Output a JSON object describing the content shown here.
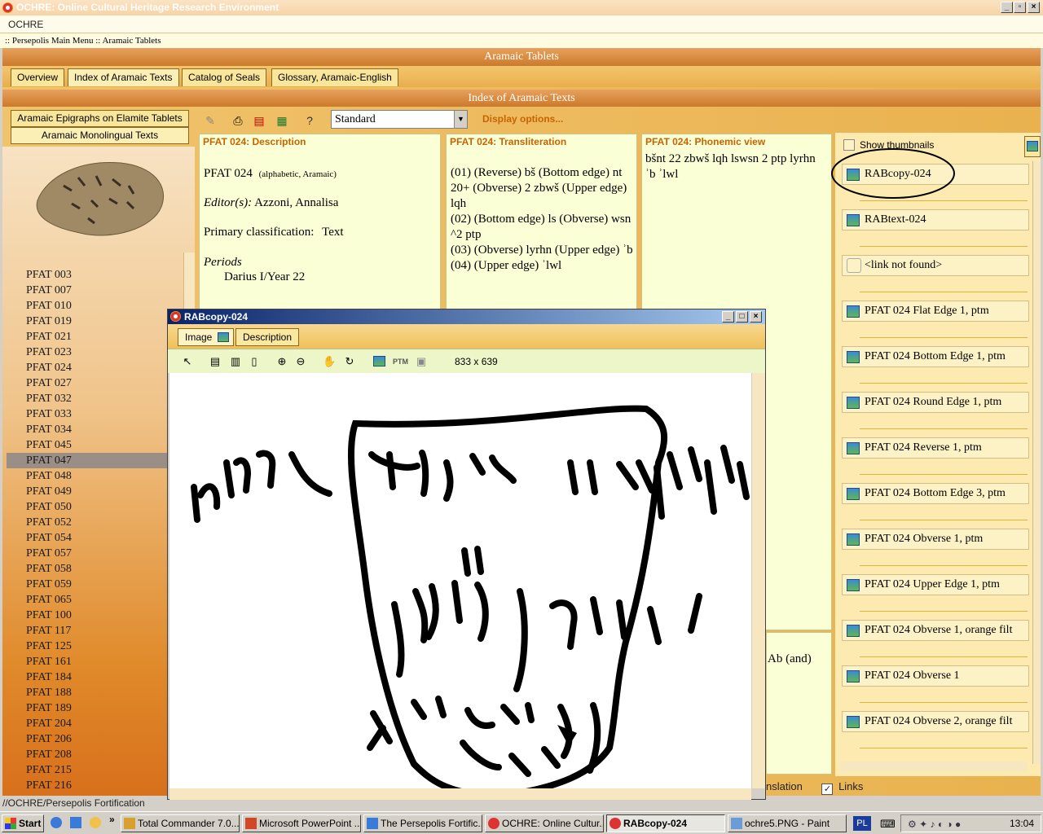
{
  "window": {
    "title": "OCHRE: Online Cultural Heritage Research Environment"
  },
  "app": {
    "name": "OCHRE",
    "breadcrumb": ":: Persepolis Main Menu :: Aramaic Tablets",
    "section_title": "Aramaic Tablets",
    "index_title": "Index of Aramaic Texts"
  },
  "tabs": [
    "Overview",
    "Index of Aramaic Texts",
    "Catalog of Seals",
    "Glossary, Aramaic-English"
  ],
  "left_tabs": [
    "Aramaic Epigraphs on Elamite Tablets",
    "Aramaic Monolingual Texts"
  ],
  "left_list": [
    "PFAT 003",
    "PFAT 007",
    "PFAT 010",
    "PFAT 019",
    "PFAT 021",
    "PFAT 023",
    "PFAT 024",
    "PFAT 027",
    "PFAT 032",
    "PFAT 033",
    "PFAT 034",
    "PFAT 045",
    "PFAT 047",
    "PFAT 048",
    "PFAT 049",
    "PFAT 050",
    "PFAT 052",
    "PFAT 054",
    "PFAT 057",
    "PFAT 058",
    "PFAT 059",
    "PFAT 065",
    "PFAT 100",
    "PFAT 117",
    "PFAT 125",
    "PFAT 161",
    "PFAT 184",
    "PFAT 188",
    "PFAT 189",
    "PFAT 204",
    "PFAT 206",
    "PFAT 208",
    "PFAT 215",
    "PFAT 216"
  ],
  "selected_left": "PFAT 047",
  "toolbar": {
    "view_select": "Standard",
    "display_options": "Display options..."
  },
  "description": {
    "header": "PFAT 024: Description",
    "title": "PFAT 024",
    "title_note": "(alphabetic, Aramaic)",
    "editor_label": "Editor(s):",
    "editor": "Azzoni, Annalisa",
    "class_label": "Primary classification:",
    "class_value": "Text",
    "periods_label": "Periods",
    "period": "Darius I/Year 22"
  },
  "transliteration": {
    "header": "PFAT 024: Transliteration",
    "lines": [
      "(01)  (Reverse) bš (Bottom edge) nt 20+ (Obverse) 2 zbwš  (Upper edge) lqh",
      "(02)  (Bottom edge) ls (Obverse) wsn ^2 ptp",
      "(03)  (Obverse) lyrhn  (Upper edge) ʾb",
      "(04)  (Upper edge) ʾlwl"
    ]
  },
  "phonemic": {
    "header": "PFAT 024: Phonemic view",
    "text": "bšnt 22 zbwš lqh lswsn 2 ptp lyrhn ʾb ʾlwl"
  },
  "translation_fragment": "Ab (and)",
  "right_panel": {
    "show_thumbnails": "Show thumbnails",
    "items": [
      "RABcopy-024",
      "RABtext-024",
      "<link not found>",
      "PFAT 024 Flat Edge 1, ptm",
      "PFAT 024 Bottom Edge 1, ptm",
      "PFAT 024 Round Edge 1, ptm",
      "PFAT 024 Reverse 1, ptm",
      "PFAT 024 Bottom Edge 3, ptm",
      "PFAT 024 Obverse 1, ptm",
      "PFAT 024 Upper Edge 1, ptm",
      "PFAT 024 Obverse 1, orange filt",
      "PFAT 024 Obverse 1",
      "PFAT 024 Obverse 2, orange filt"
    ]
  },
  "bottom": {
    "translation_label": "nslation",
    "links_label": "Links",
    "links_checked": true,
    "status_path": "//OCHRE/Persepolis Fortification Archive"
  },
  "dialog": {
    "title": "RABcopy-024",
    "tabs": [
      "Image",
      "Description"
    ],
    "dimensions": "833 x 639"
  },
  "taskbar": {
    "start": "Start",
    "tasks": [
      "Total Commander 7.0...",
      "Microsoft PowerPoint ...",
      "The Persepolis Fortific...",
      "OCHRE: Online Cultur...",
      "RABcopy-024",
      "ochre5.PNG - Paint"
    ],
    "lang": "PL",
    "clock": "13:04"
  },
  "colors": {
    "accent_orange": "#c86400",
    "panel_yellow": "#fbffd6",
    "tab_gold": "#f9e69b"
  }
}
